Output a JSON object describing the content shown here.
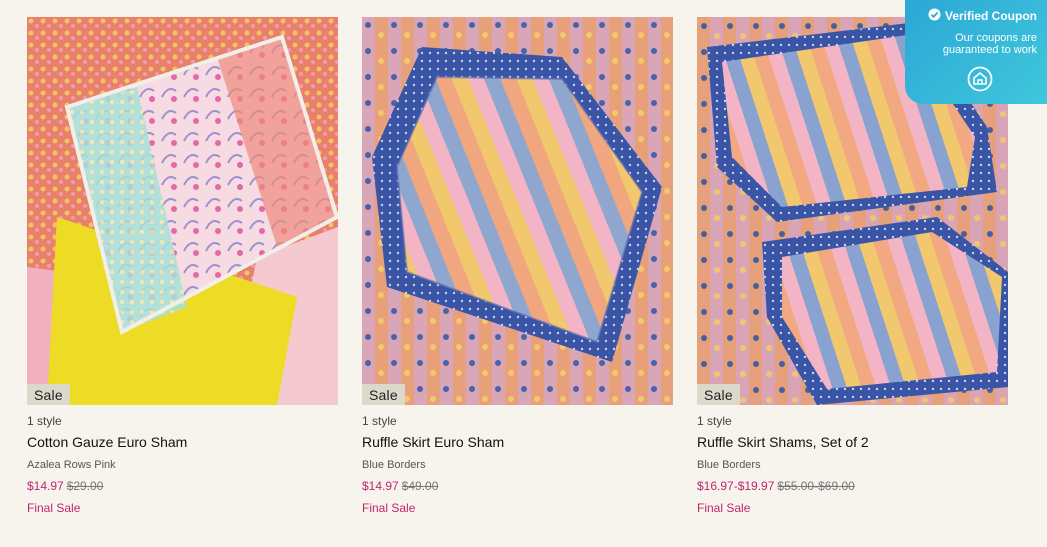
{
  "coupon": {
    "title": "Verified Coupon",
    "line1": "Our coupons are",
    "line2": "guaranteed to work"
  },
  "products": [
    {
      "badge": "Sale",
      "styles": "1 style",
      "title": "Cotton Gauze Euro Sham",
      "color": "Azalea Rows Pink",
      "price_sale": "$14.97",
      "price_orig": "$29.00",
      "final": "Final Sale"
    },
    {
      "badge": "Sale",
      "styles": "1 style",
      "title": "Ruffle Skirt Euro Sham",
      "color": "Blue Borders",
      "price_sale": "$14.97",
      "price_orig": "$49.00",
      "final": "Final Sale"
    },
    {
      "badge": "Sale",
      "styles": "1 style",
      "title": "Ruffle Skirt Shams, Set of 2",
      "color": "Blue Borders",
      "price_sale": "$16.97-$19.97",
      "price_orig": "$55.00-$69.00",
      "final": "Final Sale"
    }
  ]
}
